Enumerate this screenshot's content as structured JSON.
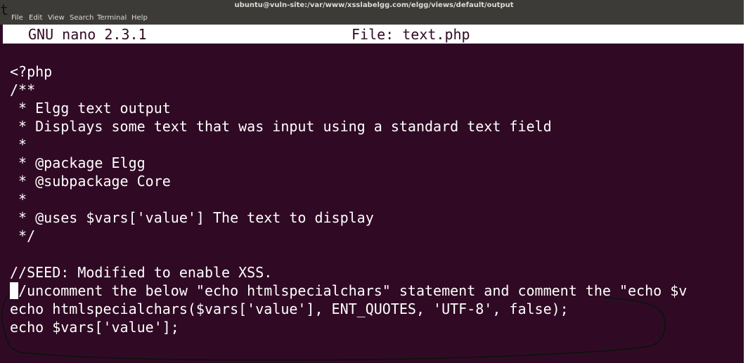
{
  "window": {
    "title": "ubuntu@vuln-site:/var/www/xsslabelgg.com/elgg/views/default/output"
  },
  "menu": [
    "File",
    "Edit",
    "View",
    "Search",
    "Terminal",
    "Help"
  ],
  "corner_marks": [
    "t",
    "t"
  ],
  "nano": {
    "version": "GNU nano 2.3.1",
    "file": "File: text.php"
  },
  "code_lines": [
    "<?php",
    "/**",
    " * Elgg text output",
    " * Displays some text that was input using a standard text field",
    " *",
    " * @package Elgg",
    " * @subpackage Core",
    " *",
    " * @uses $vars['value'] The text to display",
    " */",
    "",
    "//SEED: Modified to enable XSS.",
    "//uncomment the below \"echo htmlspecialchars\" statement and comment the \"echo $v",
    "echo htmlspecialchars($vars['value'], ENT_QUOTES, 'UTF-8', false);",
    "echo $vars['value'];"
  ],
  "colors": {
    "terminal_bg": "#300a24",
    "text": "#ffffff",
    "titlebar": "#3c3b37",
    "annotation": "#111111"
  }
}
